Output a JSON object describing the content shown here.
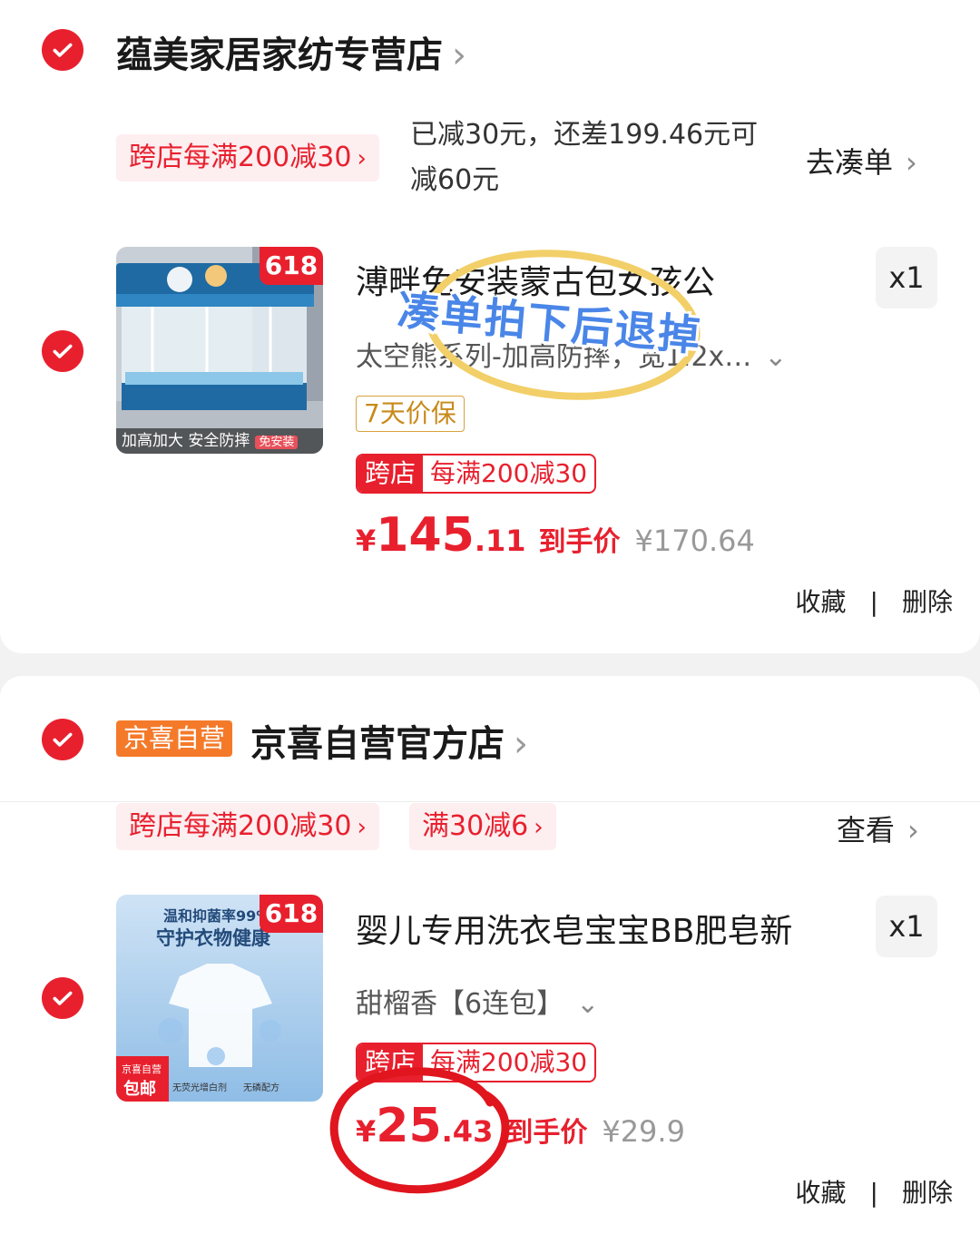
{
  "store1": {
    "name": "蕴美家居家纺专营店",
    "promo_tag": "跨店每满200减30",
    "promo_msg": "已减30元，还差199.46元可减60元",
    "action": "去凑单",
    "product": {
      "badge": "618",
      "thumb_caption": "加高加大  安全防摔",
      "thumb_mini": "免安装",
      "title": "溥畔免安装蒙古包女孩公",
      "spec": "太空熊系列-加高防摔，宽1.2x…",
      "qty": "x1",
      "guarantee": "7天价保",
      "cross_left": "跨店",
      "cross_right": "每满200减30",
      "price_yen": "¥",
      "price_int": "145",
      "price_dec": ".11",
      "price_label": "到手价",
      "orig_price": "¥170.64",
      "fav": "收藏",
      "sep": "|",
      "delete": "删除"
    },
    "sticker": "凑单拍下后退掉"
  },
  "store2": {
    "tag": "京喜自营",
    "name": "京喜自营官方店",
    "promo_tag1": "跨店每满200减30",
    "promo_tag2": "满30减6",
    "action": "查看",
    "product": {
      "badge": "618",
      "thumb_line1": "温和抑菌率99%",
      "thumb_line2": "守护衣物健康",
      "thumb_ship1": "京喜自营",
      "thumb_ship2": "包邮",
      "thumb_feat1": "无荧光增白剂",
      "thumb_feat2": "无磷配方",
      "title": "婴儿专用洗衣皂宝宝BB肥皂新",
      "spec": "甜榴香【6连包】",
      "qty": "x1",
      "cross_left": "跨店",
      "cross_right": "每满200减30",
      "price_yen": "¥",
      "price_int": "25",
      "price_dec": ".43",
      "price_label": "到手价",
      "orig_price": "¥29.9",
      "fav": "收藏",
      "sep": "|",
      "delete": "删除"
    }
  },
  "icons": {
    "check": "check-icon",
    "chevron_right": "chevron-right-icon",
    "chevron_down": "chevron-down-icon"
  },
  "colors": {
    "accent": "#e8202e",
    "promo_bg": "#fdeef0",
    "jx_orange": "#f47a2a",
    "guarantee": "#c78a1a",
    "sticker_blue": "#4a86e8",
    "annotation_red": "#e0151e"
  }
}
